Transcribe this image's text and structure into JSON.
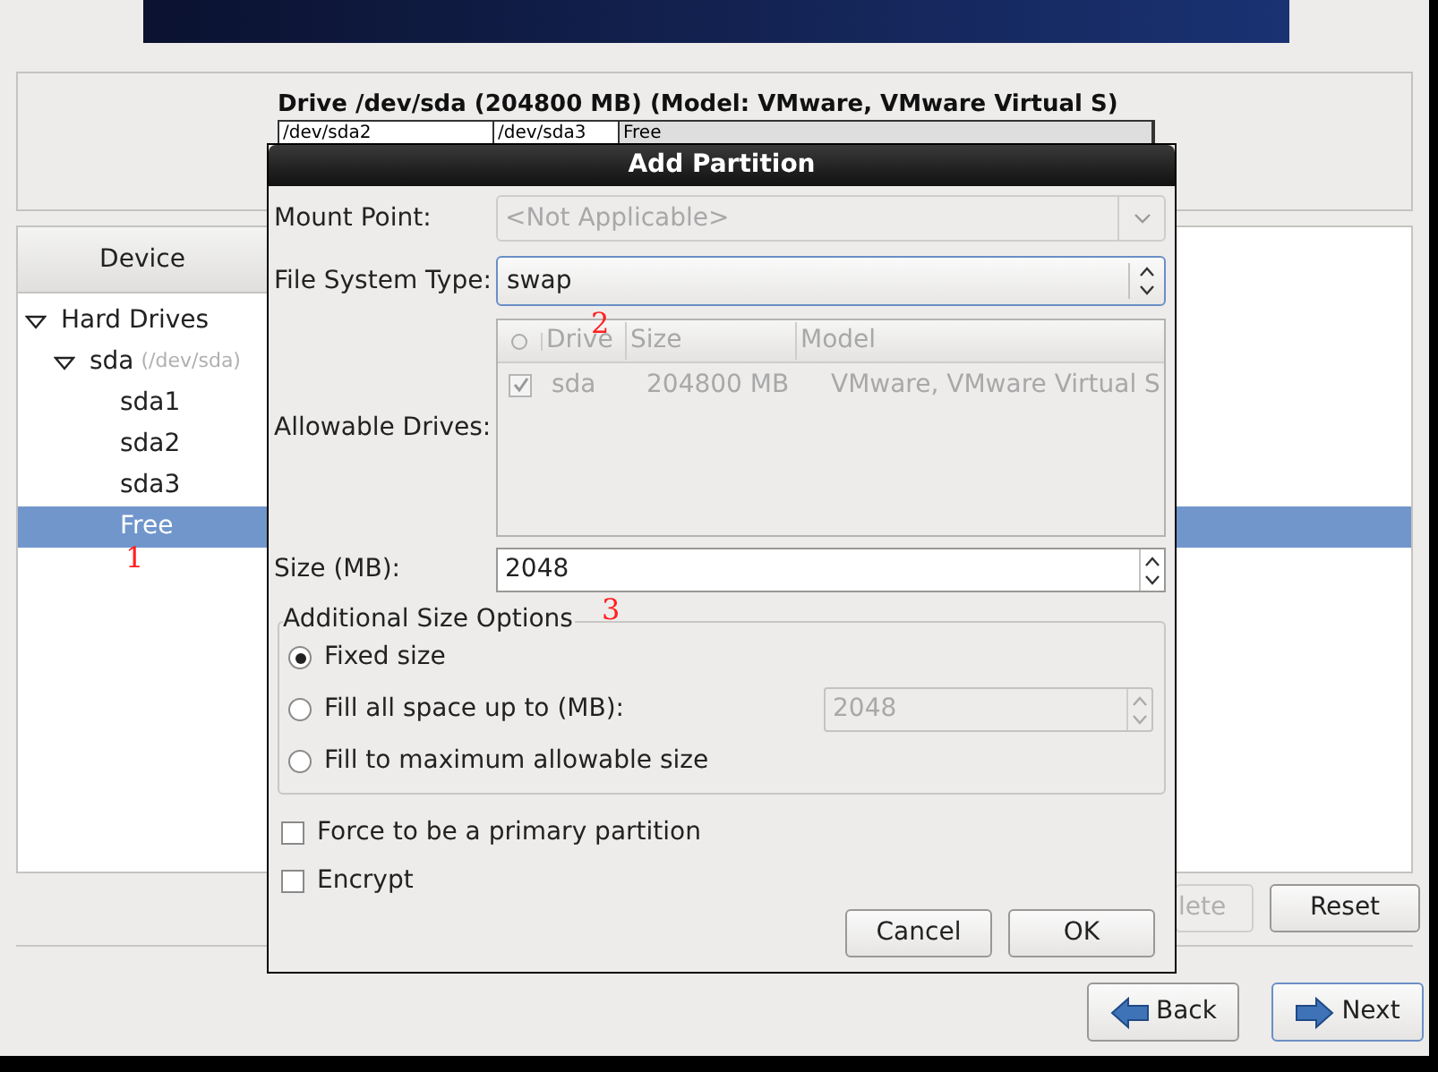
{
  "drive": {
    "title": "Drive /dev/sda (204800 MB) (Model: VMware, VMware Virtual S)",
    "segments": [
      {
        "label": "/dev/sda2",
        "kind": "partition"
      },
      {
        "label": "/dev/sda3",
        "kind": "partition"
      },
      {
        "label": "Free",
        "kind": "free"
      }
    ]
  },
  "device_tree": {
    "header": "Device",
    "items": [
      {
        "label": "Hard Drives",
        "expanded": true,
        "selected": false,
        "children": [
          {
            "label": "sda",
            "detail": "(/dev/sda)",
            "expanded": true,
            "selected": false,
            "children": [
              {
                "label": "sda1",
                "selected": false
              },
              {
                "label": "sda2",
                "selected": false
              },
              {
                "label": "sda3",
                "selected": false
              },
              {
                "label": "Free",
                "selected": true
              }
            ]
          }
        ]
      }
    ]
  },
  "tree_buttons": [
    {
      "label": "lete",
      "disabled": true
    },
    {
      "label": "Reset",
      "disabled": false
    }
  ],
  "nav_buttons": [
    {
      "label": "Back",
      "kind": "back",
      "focused": false
    },
    {
      "label": "Next",
      "kind": "next",
      "focused": true
    }
  ],
  "dialog": {
    "title": "Add Partition",
    "mount_point": {
      "label": "Mount Point:",
      "value": "<Not Applicable>",
      "disabled": true
    },
    "file_system_type": {
      "label": "File System Type:",
      "value": "swap",
      "focused": true
    },
    "allowable_drives": {
      "label": "Allowable Drives:",
      "disabled": true,
      "columns": [
        "Drive",
        "Size",
        "Model"
      ],
      "rows": [
        {
          "checked": true,
          "drive": "sda",
          "size": "204800 MB",
          "model": "VMware, VMware Virtual S"
        }
      ]
    },
    "size": {
      "label": "Size (MB):",
      "value": "2048"
    },
    "size_options": {
      "title": "Additional Size Options",
      "options": [
        {
          "label": "Fixed size",
          "selected": true,
          "kind": "plain"
        },
        {
          "label": "Fill all space up to (MB):",
          "selected": false,
          "kind": "spin",
          "value": "2048",
          "disabled": true
        },
        {
          "label": "Fill to maximum allowable size",
          "selected": false,
          "kind": "plain"
        }
      ]
    },
    "checkboxes": [
      {
        "label": "Force to be a primary partition",
        "checked": false
      },
      {
        "label": "Encrypt",
        "checked": false
      }
    ],
    "buttons": [
      "Cancel",
      "OK"
    ]
  },
  "annotations": [
    {
      "text": "1"
    },
    {
      "text": "2"
    },
    {
      "text": "3"
    }
  ]
}
